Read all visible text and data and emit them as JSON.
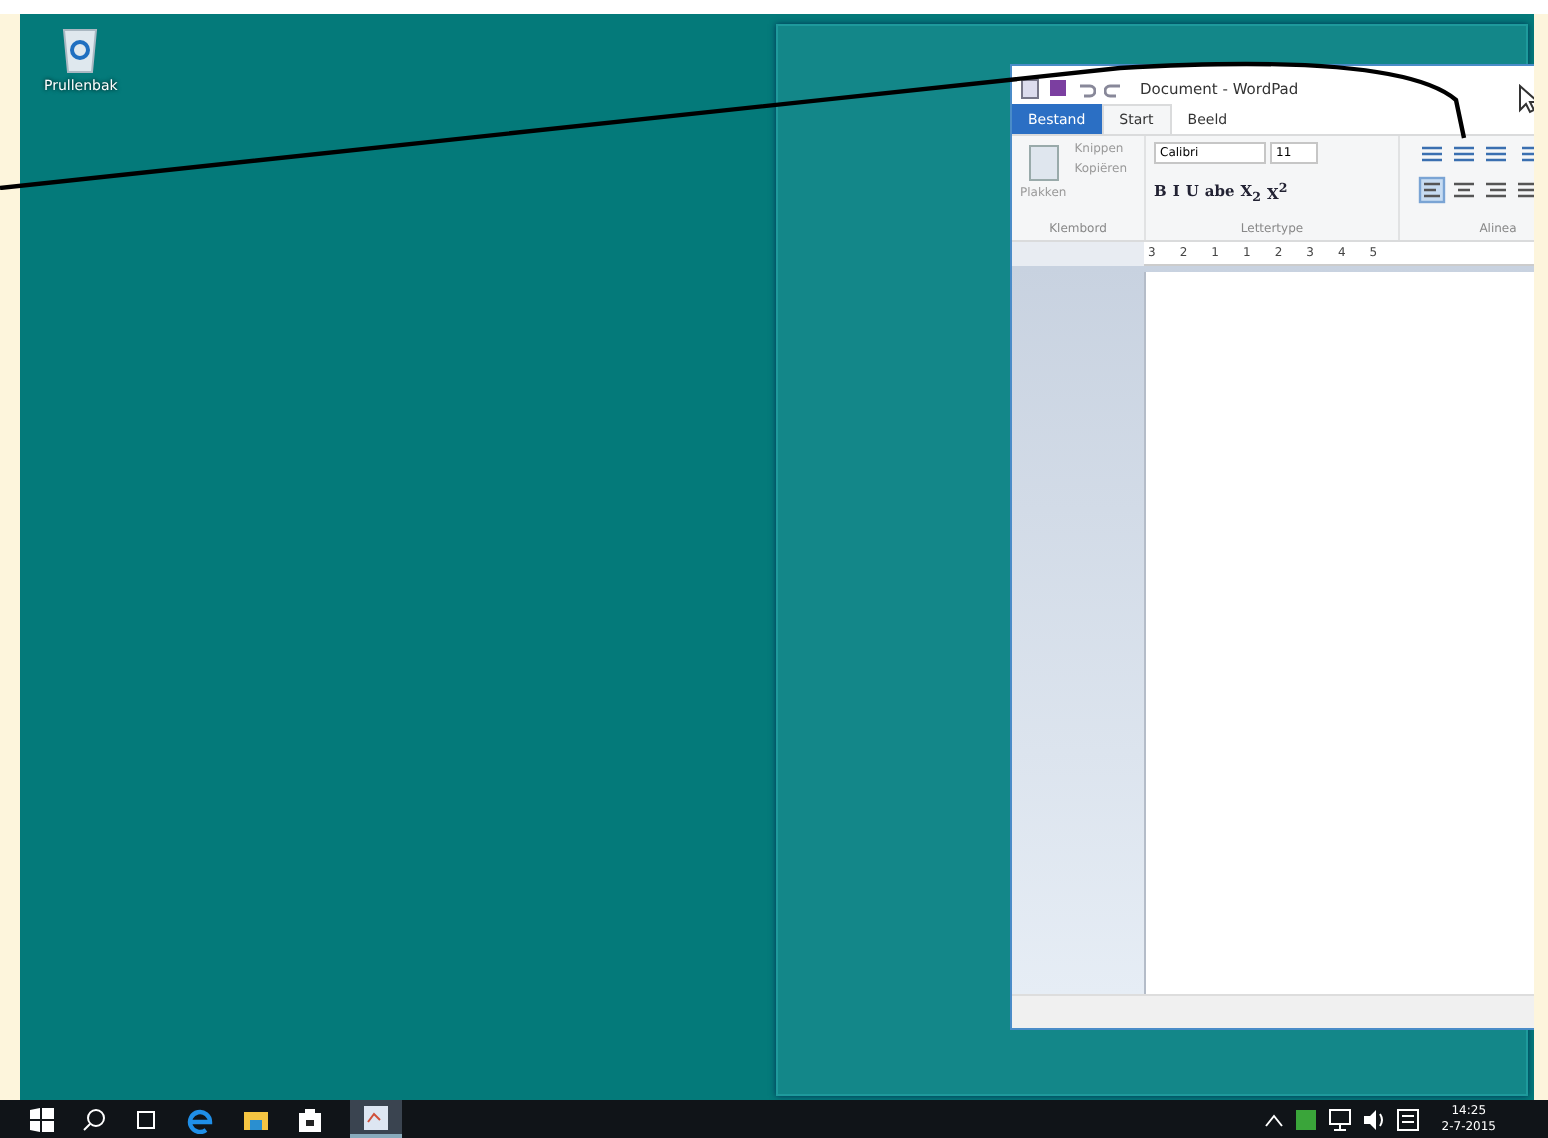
{
  "desktop": {
    "icons": [
      {
        "label": "Prullenbak"
      }
    ]
  },
  "window": {
    "title": "Document - WordPad",
    "tabs": [
      {
        "label": "Bestand",
        "kind": "file",
        "selected": false
      },
      {
        "label": "Start",
        "kind": "tab",
        "selected": true
      },
      {
        "label": "Beeld",
        "kind": "tab",
        "selected": false
      }
    ],
    "clipboard": {
      "paste": "Plakken",
      "cut": "Knippen",
      "copy": "Kopiëren",
      "label": "Klembord"
    },
    "font": {
      "family": "Calibri",
      "size": "11",
      "format_buttons": [
        "B",
        "I",
        "U",
        "abe",
        "X$_{2}$",
        "X$^{2}$"
      ],
      "label": "Lettertype"
    },
    "paragraph": {
      "label": "Alinea"
    },
    "ruler": [
      "3",
      "2",
      "1",
      "1",
      "2",
      "3",
      "4",
      "5"
    ]
  },
  "taskbar": {
    "time": "14:25",
    "date": "2-7-2015"
  }
}
